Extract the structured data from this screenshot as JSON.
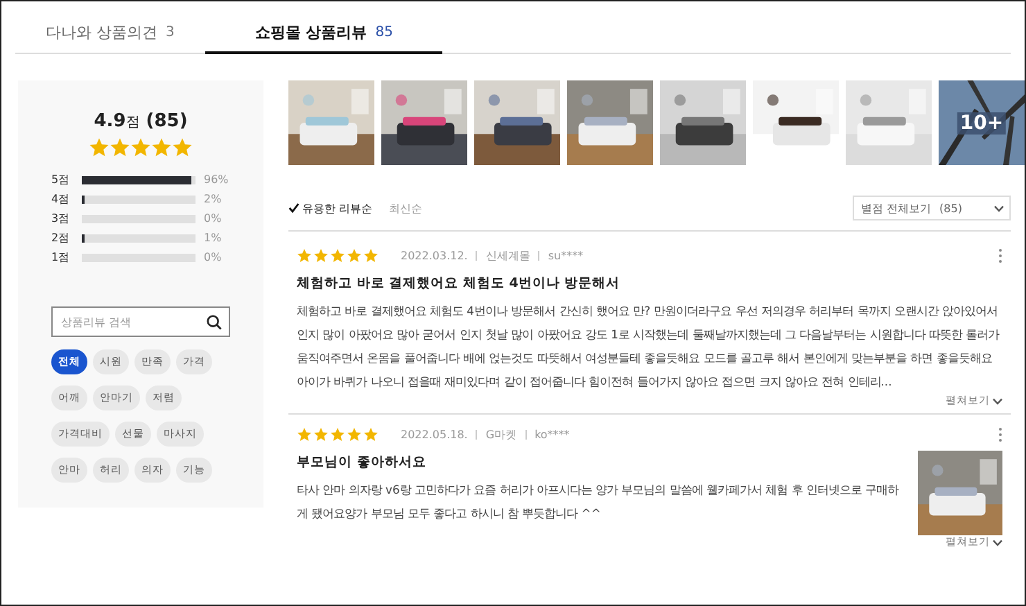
{
  "tabs": [
    {
      "label": "다나와 상품의견",
      "count": "3",
      "selected": false
    },
    {
      "label": "쇼핑몰 상품리뷰",
      "count": "85",
      "selected": true
    }
  ],
  "summary": {
    "score": "4.9",
    "unit": "점",
    "count": "(85)",
    "stars": 5,
    "distribution": [
      {
        "label": "5점",
        "level": 0.96,
        "percent": "96%"
      },
      {
        "label": "4점",
        "level": 0.02,
        "percent": "2%"
      },
      {
        "label": "3점",
        "level": 0,
        "percent": "0%"
      },
      {
        "label": "2점",
        "level": 0.01,
        "percent": "1%"
      },
      {
        "label": "1점",
        "level": 0,
        "percent": "0%"
      }
    ],
    "search": {
      "placeholder": "상품리뷰 검색"
    },
    "keywords": [
      {
        "label": "전체",
        "selected": true
      },
      {
        "label": "시원",
        "selected": false
      },
      {
        "label": "만족",
        "selected": false
      },
      {
        "label": "가격",
        "selected": false
      },
      {
        "label": "어깨",
        "selected": false
      },
      {
        "label": "안마기",
        "selected": false
      },
      {
        "label": "저렴",
        "selected": false
      },
      {
        "label": "가격대비",
        "selected": false
      },
      {
        "label": "선물",
        "selected": false
      },
      {
        "label": "마사지",
        "selected": false
      },
      {
        "label": "안마",
        "selected": false
      },
      {
        "label": "허리",
        "selected": false
      },
      {
        "label": "의자",
        "selected": false
      },
      {
        "label": "기능",
        "selected": false
      }
    ]
  },
  "photos": [
    {
      "kind": "picture"
    },
    {
      "kind": "picture"
    },
    {
      "kind": "picture"
    },
    {
      "kind": "picture"
    },
    {
      "kind": "picture"
    },
    {
      "kind": "picture"
    },
    {
      "kind": "picture"
    },
    {
      "kind": "more",
      "label": "10+"
    }
  ],
  "sort_options": [
    {
      "label": "유용한 리뷰순",
      "selected": true
    },
    {
      "label": "최신순",
      "selected": false
    }
  ],
  "filter": {
    "label": "별점 전체보기",
    "count": "(85)"
  },
  "reviews": [
    {
      "stars": 5,
      "date": "2022.03.12.",
      "mall": "신세계몰",
      "user": "su****",
      "title": "체험하고 바로 결제했어요 체험도 4번이나 방문해서",
      "body": "체험하고 바로 결제했어요 체험도 4번이나 방문해서 간신히 했어요 만? 만원이더라구요 우선 저의경우 허리부터 목까지 오랜시간 앉아있어서인지 많이 아팠어요 많아 굳어서 인지 첫날 많이 아팠어요 강도 1로 시작했는데 둘째날까지했는데 그 다음날부터는 시원합니다 따뜻한 롤러가 움직여주면서 온몸을 풀어줍니다 배에 얹는것도 따뜻해서 여성분들테 좋을듯해요 모드를 골고루 해서 본인에게 맞는부분을 하면 좋을듯해요 아이가 바퀴가 나오니 접을때 재미있다며 같이 접어줍니다 힘이전혀 들어가지 않아요 접으면 크지 않아요 전혀 인테리...",
      "more": "펼쳐보기",
      "photo": false
    },
    {
      "stars": 5,
      "date": "2022.05.18.",
      "mall": "G마켓",
      "user": "ko****",
      "title": "부모님이 좋아하서요",
      "body": "타사 안마 의자랑 v6랑 고민하다가 요즘 허리가 아프시다는 양가 부모님의 말씀에 웰카페가서 체험 후 인터넷으로 구매하게 됐어요양가 부모님 모두 좋다고 하시니 참 뿌듯합니다 ^^",
      "more": "펼쳐보기",
      "photo": true
    }
  ]
}
